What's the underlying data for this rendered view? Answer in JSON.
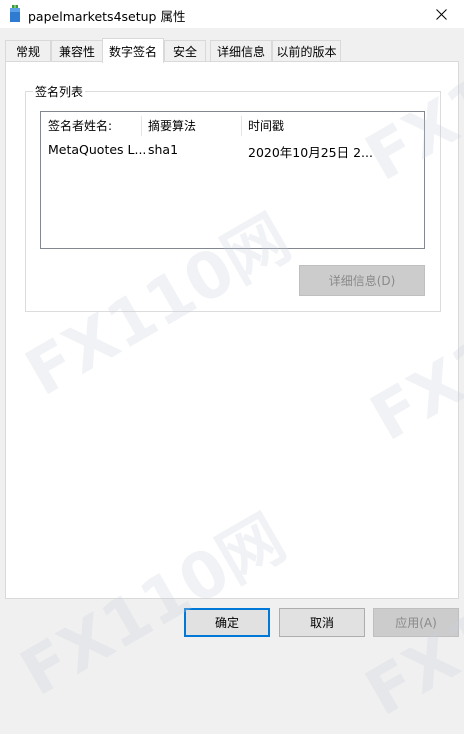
{
  "window": {
    "title": "papelmarkets4setup 属性",
    "icon": "installer-app-icon",
    "close_icon": "close-icon"
  },
  "tabs": [
    {
      "label": "常规"
    },
    {
      "label": "兼容性"
    },
    {
      "label": "数字签名",
      "active": true
    },
    {
      "label": "安全"
    },
    {
      "label": "详细信息"
    },
    {
      "label": "以前的版本"
    }
  ],
  "signature_list": {
    "group_label": "签名列表",
    "columns": [
      "签名者姓名:",
      "摘要算法",
      "时间戳"
    ],
    "rows": [
      [
        "MetaQuotes L...",
        "sha1",
        "2020年10月25日 2..."
      ]
    ],
    "details_button": "详细信息(D)"
  },
  "footer": {
    "ok": "确定",
    "cancel": "取消",
    "apply": "应用(A)"
  },
  "watermark": {
    "text": "FX110网"
  },
  "colors": {
    "accent": "#0078d7",
    "disabled_text": "#8a8a8a"
  }
}
